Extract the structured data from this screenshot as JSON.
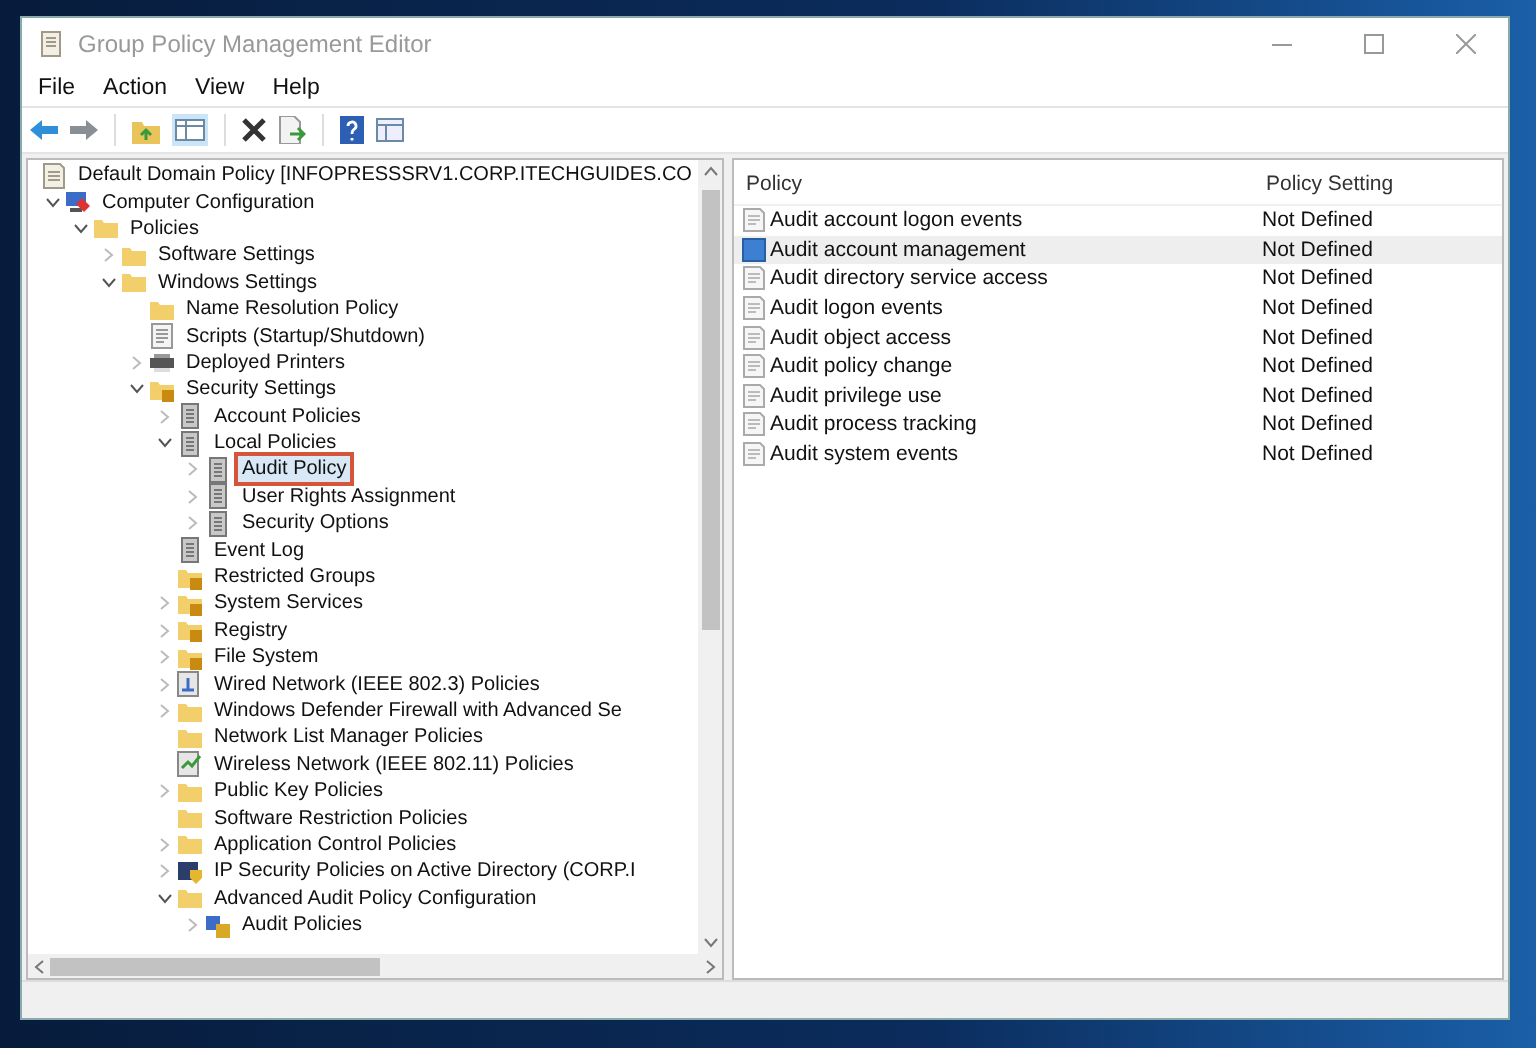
{
  "window": {
    "title": "Group Policy Management Editor"
  },
  "menu": [
    "File",
    "Action",
    "View",
    "Help"
  ],
  "tree": [
    {
      "label": "Default Domain Policy [INFOPRESSSRV1.CORP.ITECHGUIDES.CO",
      "kind": "document",
      "selected": false,
      "children": [
        {
          "label": "Computer Configuration",
          "kind": "computer",
          "expanded": true,
          "selected": false,
          "children": [
            {
              "label": "Policies",
              "kind": "folder",
              "expanded": true,
              "selected": false,
              "children": [
                {
                  "label": "Software Settings",
                  "kind": "folder",
                  "expanded": false,
                  "selected": false
                },
                {
                  "label": "Windows Settings",
                  "kind": "folder",
                  "expanded": true,
                  "selected": false,
                  "children": [
                    {
                      "label": "Name Resolution Policy",
                      "kind": "folder",
                      "selected": false
                    },
                    {
                      "label": "Scripts (Startup/Shutdown)",
                      "kind": "script",
                      "selected": false
                    },
                    {
                      "label": "Deployed Printers",
                      "kind": "printer",
                      "expanded": false,
                      "selected": false
                    },
                    {
                      "label": "Security Settings",
                      "kind": "security",
                      "expanded": true,
                      "selected": false,
                      "children": [
                        {
                          "label": "Account Policies",
                          "kind": "book",
                          "expanded": false,
                          "selected": false
                        },
                        {
                          "label": "Local Policies",
                          "kind": "book",
                          "expanded": true,
                          "selected": false,
                          "children": [
                            {
                              "label": "Audit Policy",
                              "kind": "book",
                              "expanded": false,
                              "selected": true
                            },
                            {
                              "label": "User Rights Assignment",
                              "kind": "book",
                              "expanded": false,
                              "selected": false
                            },
                            {
                              "label": "Security Options",
                              "kind": "book",
                              "expanded": false,
                              "selected": false
                            }
                          ]
                        },
                        {
                          "label": "Event Log",
                          "kind": "book",
                          "selected": false
                        },
                        {
                          "label": "Restricted Groups",
                          "kind": "security",
                          "selected": false
                        },
                        {
                          "label": "System Services",
                          "kind": "security",
                          "expanded": false,
                          "selected": false
                        },
                        {
                          "label": "Registry",
                          "kind": "security",
                          "expanded": false,
                          "selected": false
                        },
                        {
                          "label": "File System",
                          "kind": "security",
                          "expanded": false,
                          "selected": false
                        },
                        {
                          "label": "Wired Network (IEEE 802.3) Policies",
                          "kind": "network",
                          "expanded": false,
                          "selected": false
                        },
                        {
                          "label": "Windows Defender Firewall with Advanced Se",
                          "kind": "folder",
                          "expanded": false,
                          "selected": false
                        },
                        {
                          "label": "Network List Manager Policies",
                          "kind": "folder",
                          "selected": false
                        },
                        {
                          "label": "Wireless Network (IEEE 802.11) Policies",
                          "kind": "wireless",
                          "selected": false
                        },
                        {
                          "label": "Public Key Policies",
                          "kind": "folder",
                          "expanded": false,
                          "selected": false
                        },
                        {
                          "label": "Software Restriction Policies",
                          "kind": "folder",
                          "selected": false
                        },
                        {
                          "label": "Application Control Policies",
                          "kind": "folder",
                          "expanded": false,
                          "selected": false
                        },
                        {
                          "label": "IP Security Policies on Active Directory (CORP.I",
                          "kind": "ipsec",
                          "expanded": false,
                          "selected": false
                        },
                        {
                          "label": "Advanced Audit Policy Configuration",
                          "kind": "folder",
                          "expanded": true,
                          "selected": false,
                          "children": [
                            {
                              "label": "Audit Policies",
                              "kind": "audit",
                              "expanded": false,
                              "selected": false
                            }
                          ]
                        }
                      ]
                    }
                  ]
                }
              ]
            }
          ]
        }
      ]
    }
  ],
  "list": {
    "columns": [
      "Policy",
      "Policy Setting"
    ],
    "rows": [
      {
        "policy": "Audit account logon events",
        "setting": "Not Defined",
        "selected": false
      },
      {
        "policy": "Audit account management",
        "setting": "Not Defined",
        "selected": true
      },
      {
        "policy": "Audit directory service access",
        "setting": "Not Defined",
        "selected": false
      },
      {
        "policy": "Audit logon events",
        "setting": "Not Defined",
        "selected": false
      },
      {
        "policy": "Audit object access",
        "setting": "Not Defined",
        "selected": false
      },
      {
        "policy": "Audit policy change",
        "setting": "Not Defined",
        "selected": false
      },
      {
        "policy": "Audit privilege use",
        "setting": "Not Defined",
        "selected": false
      },
      {
        "policy": "Audit process tracking",
        "setting": "Not Defined",
        "selected": false
      },
      {
        "policy": "Audit system events",
        "setting": "Not Defined",
        "selected": false
      }
    ]
  }
}
